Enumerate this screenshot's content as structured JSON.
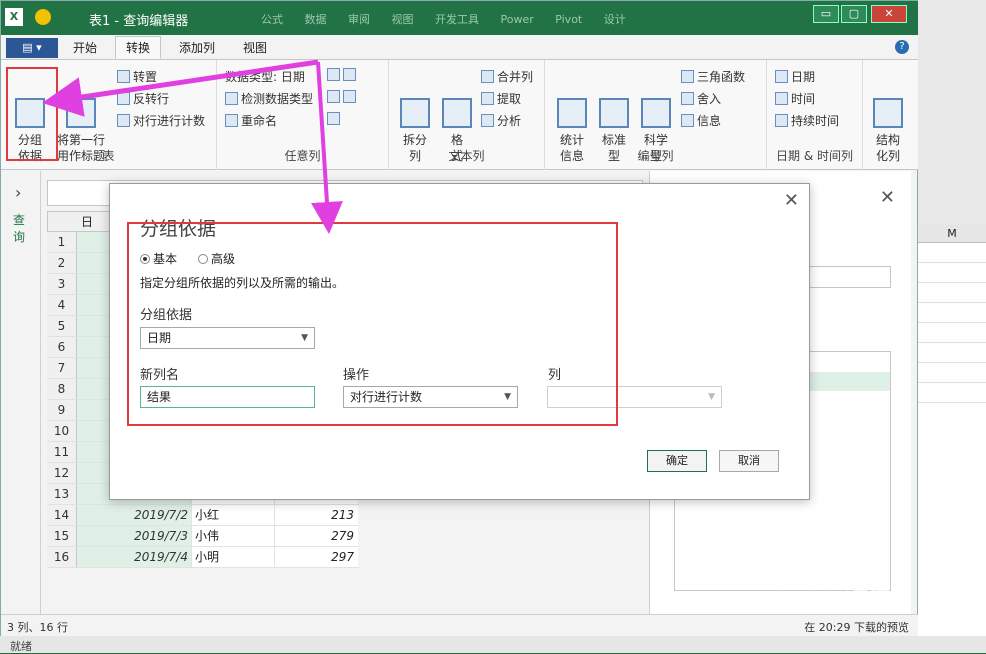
{
  "titlebar": {
    "app_icon": "excel-icon",
    "title": "表1 - 查询编辑器",
    "bg_tabs": "公式 数据 审阅 视图 开发工具 Power Pivot 设计",
    "minimize": "▭",
    "maximize": "▢",
    "close": "✕"
  },
  "ribbon_tabs": {
    "file": "▤ ▾",
    "tabs": [
      "开始",
      "转换",
      "添加列",
      "视图"
    ],
    "active": "转换",
    "help": "?"
  },
  "ribbon": {
    "table_group": {
      "label": "表",
      "group_by": "分组\n依据",
      "use_first_row": "将第一行\n用作标题",
      "transpose": "转置",
      "reverse_rows": "反转行",
      "count_rows": "对行进行计数"
    },
    "any_column_group": {
      "label": "任意列",
      "data_type": "数据类型: 日期",
      "detect_type": "检测数据类型",
      "rename": "重命名"
    },
    "text_column_group": {
      "label": "文本列",
      "split_column": "拆分\n列",
      "format": "格\n式",
      "merge_columns": "合并列",
      "extract": "提取",
      "parse": "分析"
    },
    "number_column_group": {
      "label": "编号列",
      "statistics": "统计\n信息",
      "standard": "标准\n型",
      "scientific": "科学\n型",
      "trigonometry": "三角函数",
      "rounding": "舍入",
      "information": "信息"
    },
    "datetime_group": {
      "label": "日期 & 时间列",
      "date": "日期",
      "time": "时间",
      "duration": "持续时间"
    },
    "structured_group": {
      "structured_column": "结构\n化列"
    }
  },
  "navpane": {
    "chevron": "›",
    "label": "查询"
  },
  "grid": {
    "col_header": "日",
    "rows": [
      {
        "n": "1",
        "date": "",
        "name": "",
        "val": ""
      },
      {
        "n": "2",
        "date": "",
        "name": "",
        "val": ""
      },
      {
        "n": "3",
        "date": "",
        "name": "",
        "val": ""
      },
      {
        "n": "4",
        "date": "",
        "name": "",
        "val": ""
      },
      {
        "n": "5",
        "date": "",
        "name": "",
        "val": ""
      },
      {
        "n": "6",
        "date": "",
        "name": "",
        "val": ""
      },
      {
        "n": "7",
        "date": "",
        "name": "",
        "val": ""
      },
      {
        "n": "8",
        "date": "",
        "name": "",
        "val": ""
      },
      {
        "n": "9",
        "date": "",
        "name": "",
        "val": ""
      },
      {
        "n": "10",
        "date": "",
        "name": "",
        "val": ""
      },
      {
        "n": "11",
        "date": "",
        "name": "",
        "val": ""
      },
      {
        "n": "12",
        "date": "",
        "name": "",
        "val": ""
      },
      {
        "n": "13",
        "date": "",
        "name": "",
        "val": ""
      },
      {
        "n": "14",
        "date": "2019/7/2",
        "name": "小红",
        "val": "213"
      },
      {
        "n": "15",
        "date": "2019/7/3",
        "name": "小伟",
        "val": "279"
      },
      {
        "n": "16",
        "date": "2019/7/4",
        "name": "小明",
        "val": "297"
      }
    ]
  },
  "rightpane": {
    "close": "✕"
  },
  "status": {
    "left": "3 列、16 行",
    "right": "在 20:29 下载的预览"
  },
  "excel_bg": {
    "col_letter": "M",
    "status": "就绪"
  },
  "dialog": {
    "title": "分组依据",
    "close": "✕",
    "radio_basic": "基本",
    "radio_advanced": "高级",
    "description": "指定分组所依据的列以及所需的输出。",
    "group_by_label": "分组依据",
    "group_by_value": "日期",
    "new_col_label": "新列名",
    "new_col_value": "结果",
    "operation_label": "操作",
    "operation_value": "对行进行计数",
    "column_label": "列",
    "column_value": "",
    "ok": "确定",
    "cancel": "取消"
  },
  "watermark": {
    "brand": "Bai du 经验",
    "url": "jingyan.baidu.com"
  },
  "colors": {
    "excel_green": "#217346",
    "highlight_red": "#e03a3e",
    "arrow_magenta": "#e040e0"
  }
}
